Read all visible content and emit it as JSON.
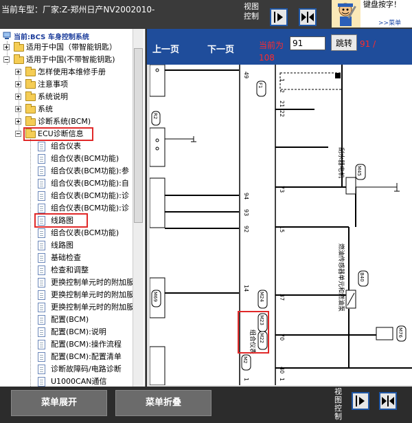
{
  "header": {
    "car_model": "当前车型：厂家:Z-郑州日产NV2002010-",
    "view_control": "视图控制"
  },
  "ad": {
    "text": "键盘按字！",
    "link": ">>菜单"
  },
  "sidebar": {
    "title": "当前:BCS 车身控制系统",
    "items": [
      {
        "label": "适用于中国（带智能钥匙）"
      },
      {
        "label": "适用于中国(不带智能钥匙)"
      },
      {
        "label": "怎样使用本维修手册"
      },
      {
        "label": "注意事项"
      },
      {
        "label": "系统说明"
      },
      {
        "label": "系统"
      },
      {
        "label": "诊断系统(BCM)"
      },
      {
        "label": "ECU诊断信息"
      },
      {
        "label": "组合仪表"
      },
      {
        "label": "组合仪表(BCM功能)"
      },
      {
        "label": "组合仪表(BCM功能):参"
      },
      {
        "label": "组合仪表(BCM功能):自"
      },
      {
        "label": "组合仪表(BCM功能):诊"
      },
      {
        "label": "组合仪表(BCM功能):诊"
      },
      {
        "label": "线路图"
      },
      {
        "label": "组合仪表(BCM功能)"
      },
      {
        "label": "线路图"
      },
      {
        "label": "基础检查"
      },
      {
        "label": "检查和调整"
      },
      {
        "label": "更换控制单元时的附加服"
      },
      {
        "label": "更换控制单元时的附加服"
      },
      {
        "label": "更换控制单元时的附加服"
      },
      {
        "label": "配置(BCM)"
      },
      {
        "label": "配置(BCM):说明"
      },
      {
        "label": "配置(BCM):操作流程"
      },
      {
        "label": "配置(BCM):配置清单"
      },
      {
        "label": "诊断故障码/电路诊断"
      },
      {
        "label": "U1000CAN通信"
      }
    ]
  },
  "viewer": {
    "prev_label": "上一页",
    "next_label": "下一页",
    "current_label": "当前为",
    "page_value": "91",
    "jump_label": "跳转",
    "page_total_a": "91 /",
    "page_total_b": "108"
  },
  "diagram": {
    "pins_left": [
      "49",
      "94",
      "93",
      "92",
      "14",
      "M24",
      "M23",
      "M22",
      "M2"
    ],
    "pins_right": [
      "1",
      "2",
      "21",
      "22",
      "73",
      "15",
      "37",
      "70",
      "40"
    ],
    "left_labels": [
      "R2",
      "M69",
      "F1"
    ],
    "connectors": [
      "M45",
      "B40",
      "M76",
      "F1"
    ],
    "component_label": "组合仪表",
    "component_label_2": "刮水器电机",
    "component_label_3": "燃油传感器单元和燃油泵",
    "bottom_pins": [
      "1",
      "1"
    ]
  },
  "bottom": {
    "expand_label": "菜单展开",
    "collapse_label": "菜单折叠",
    "view_control": "视图控制"
  },
  "colors": {
    "toolbar_blue": "#1f4d9b",
    "highlight_red": "#e02828",
    "page_red": "#ff2b2b"
  }
}
